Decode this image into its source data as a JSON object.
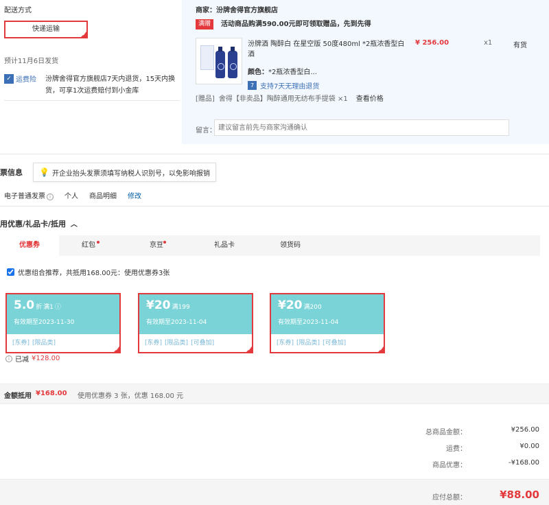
{
  "delivery": {
    "title": "配送方式",
    "method": "快递运输",
    "estimate": "预计11月6日发货",
    "insurance_badge": "运费险",
    "insurance_text": "汾牌舍得官方旗舰店7天内退货，15天内换货，可享1次运费赔付到小金库"
  },
  "shop": {
    "name": "商家：汾牌舍得官方旗舰店",
    "promo_tag": "满赠",
    "promo_text": "活动商品购满590.00元即可领取赠品，先到先得",
    "product": {
      "name": "汾牌酒 陶醉白 在星空版 50度480ml *2瓶浓香型白酒",
      "price": "¥ 256.00",
      "qty": "x1",
      "stock": "有货",
      "color_label": "颜色：",
      "color_value": "*2瓶浓香型白...",
      "return_badge": "7",
      "return_text": "支持7天无理由退货"
    },
    "gift": {
      "tag": "[赠品]",
      "text": "舍得【非卖品】陶醉通用无纺布手提袋 ×1",
      "check_price": "查看价格"
    },
    "message_label": "留言：",
    "message_placeholder": "建议留言前先与商家沟通确认"
  },
  "invoice": {
    "title": "票信息",
    "tip": "开企业抬头发票须填写纳税人识别号，以免影响报销",
    "type": "电子普通发票",
    "info_icon": "i",
    "person": "个人",
    "detail": "商品明细",
    "edit": "修改"
  },
  "coupons": {
    "title": "用优惠/礼品卡/抵用",
    "collapse_icon": "chevron-up-icon",
    "tabs": [
      {
        "label": "优惠券",
        "dot": true
      },
      {
        "label": "红包",
        "dot": true
      },
      {
        "label": "京豆",
        "dot": true
      },
      {
        "label": "礼品卡",
        "dot": false
      },
      {
        "label": "领货码",
        "dot": false
      }
    ],
    "combo_text": "优惠组合推荐，共抵用168.00元：使用优惠券3张",
    "items": [
      {
        "amount": "5.0",
        "unit": "折",
        "cond": "满1",
        "valid": "有效期至2023-11-30",
        "tags": [
          "[东券]",
          "[限品类]"
        ]
      },
      {
        "amount": "¥20",
        "unit": "",
        "cond": "满199",
        "valid": "有效期至2023-11-04",
        "tags": [
          "[东券]",
          "[限品类]",
          "[可叠加]"
        ]
      },
      {
        "amount": "¥20",
        "unit": "",
        "cond": "满200",
        "valid": "有效期至2023-11-04",
        "tags": [
          "[东券]",
          "[限品类]",
          "[可叠加]"
        ]
      }
    ],
    "reduced_label": "已减",
    "reduced_value": "¥128.00"
  },
  "amount": {
    "label": "金额抵用",
    "value": "¥168.00",
    "note": "使用优惠券 3 张，优惠 168.00 元"
  },
  "totals": {
    "rows": [
      {
        "label": "总商品金额：",
        "value": "¥256.00"
      },
      {
        "label": "运费：",
        "value": "¥0.00"
      },
      {
        "label": "商品优惠：",
        "value": "-¥168.00"
      }
    ],
    "final_label": "应付总额：",
    "final_value": "¥88.00"
  },
  "colors": {
    "accent": "#e4393c",
    "coupon": "#7ad3d6",
    "link": "#005ea7"
  }
}
